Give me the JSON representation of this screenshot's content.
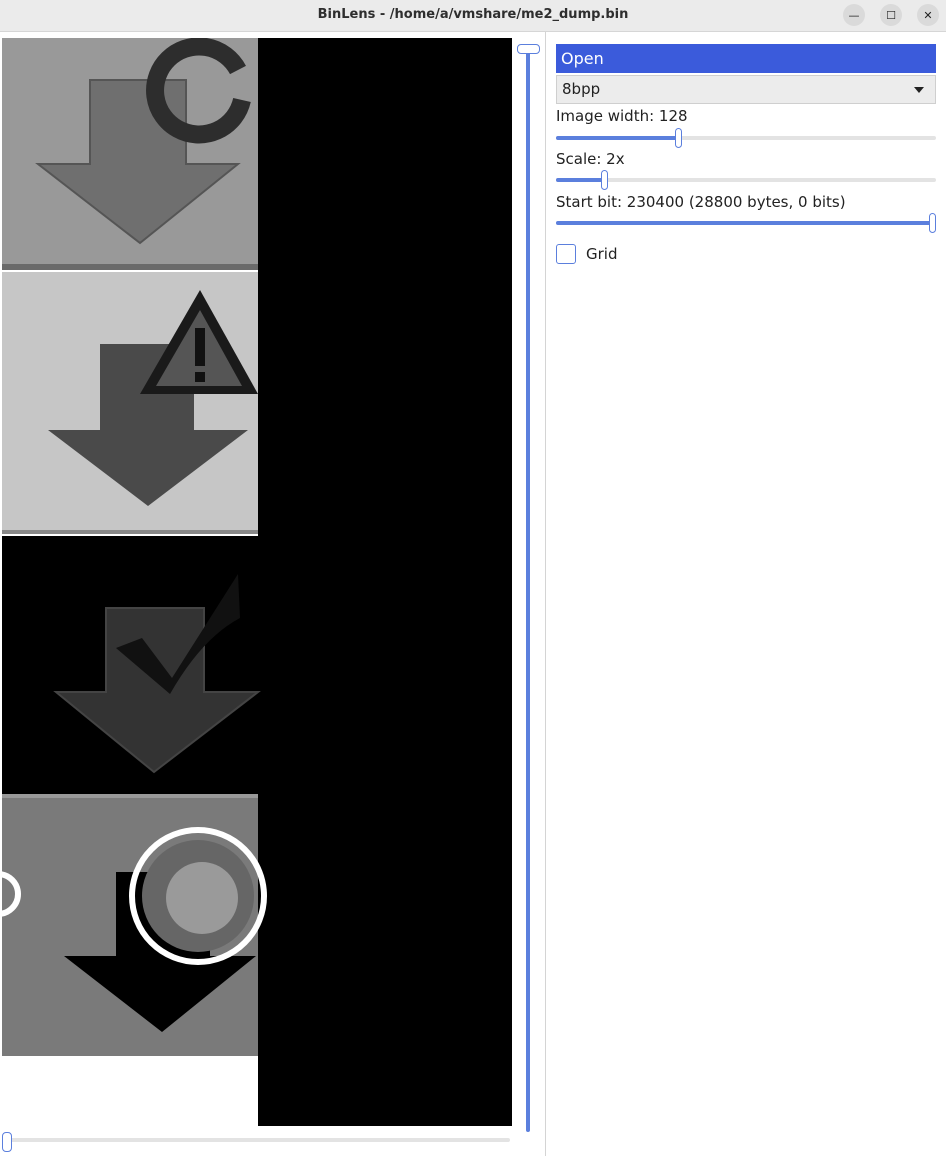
{
  "window": {
    "title": "BinLens - /home/a/vmshare/me2_dump.bin",
    "minimize_glyph": "—",
    "maximize_glyph": "☐",
    "close_glyph": "✕"
  },
  "viewer": {
    "tiles": [
      {
        "icon": "download-arrow-with-refresh-icon"
      },
      {
        "icon": "download-arrow-with-warning-icon"
      },
      {
        "icon": "download-arrow-with-checkmark-icon"
      },
      {
        "icon": "download-arrow-with-disc-icon"
      }
    ]
  },
  "controls": {
    "open_label": "Open",
    "format_selected": "8bpp",
    "image_width_label": "Image width: 128",
    "image_width_level": 0.32,
    "scale_label": "Scale: 2x",
    "scale_level": 0.12,
    "start_bit_label": "Start bit: 230400 (28800 bytes, 0 bits)",
    "start_bit_level": 1.0,
    "grid_label": "Grid",
    "grid_checked": false
  },
  "colors": {
    "accent": "#3b5bdb",
    "slider": "#5b7fdd"
  }
}
